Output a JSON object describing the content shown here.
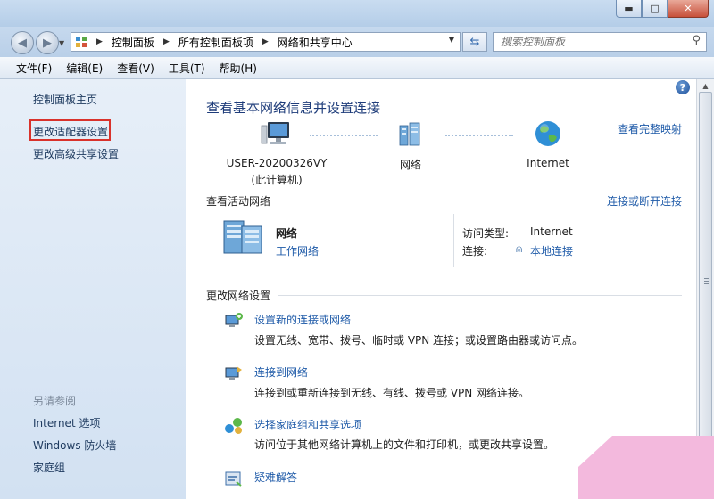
{
  "window": {
    "min": "0",
    "max": "□",
    "close": "✕"
  },
  "address": {
    "crumbs": [
      "控制面板",
      "所有控制面板项",
      "网络和共享中心"
    ]
  },
  "search": {
    "placeholder": "搜索控制面板"
  },
  "menu": [
    "文件(F)",
    "编辑(E)",
    "查看(V)",
    "工具(T)",
    "帮助(H)"
  ],
  "left": {
    "home": "控制面板主页",
    "adapter": "更改适配器设置",
    "advanced": "更改高级共享设置",
    "see_also": "另请参阅",
    "links": [
      "Internet 选项",
      "Windows 防火墙",
      "家庭组"
    ]
  },
  "main": {
    "title": "查看基本网络信息并设置连接",
    "full_map": "查看完整映射",
    "computer_name": "USER-20200326VY",
    "computer_sub": "(此计算机)",
    "network_label": "网络",
    "internet_label": "Internet",
    "active_head": "查看活动网络",
    "connect_disconnect": "连接或断开连接",
    "net_name": "网络",
    "net_type": "工作网络",
    "access_type_label": "访问类型:",
    "access_type_value": "Internet",
    "conn_label": "连接:",
    "conn_value": "本地连接",
    "change_head": "更改网络设置",
    "tasks": [
      {
        "title": "设置新的连接或网络",
        "desc": "设置无线、宽带、拨号、临时或 VPN 连接；或设置路由器或访问点。"
      },
      {
        "title": "连接到网络",
        "desc": "连接到或重新连接到无线、有线、拨号或 VPN 网络连接。"
      },
      {
        "title": "选择家庭组和共享选项",
        "desc": "访问位于其他网络计算机上的文件和打印机，或更改共享设置。"
      },
      {
        "title": "疑难解答",
        "desc": ""
      }
    ]
  },
  "colors": {
    "link": "#1e5aa8",
    "highlight": "#d9322b"
  }
}
